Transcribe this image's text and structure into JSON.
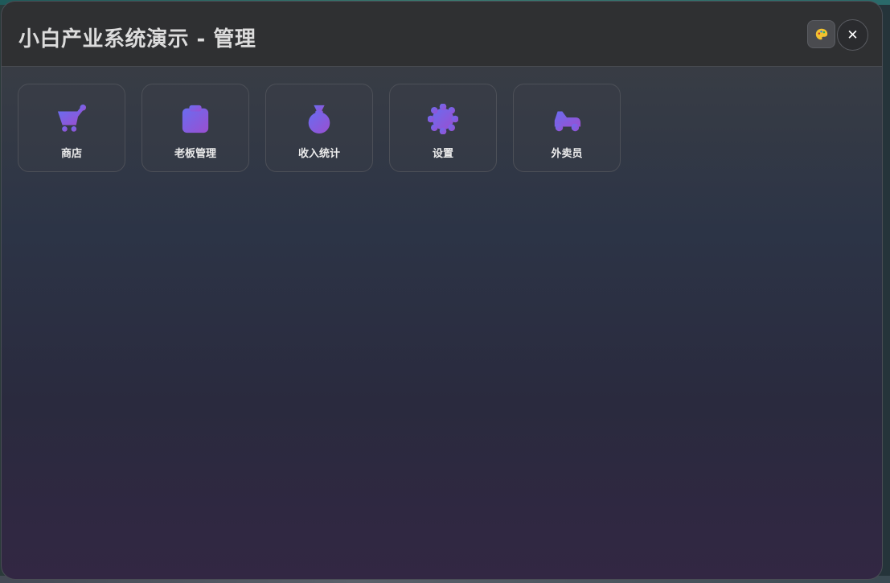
{
  "window": {
    "title": "小白产业系统演示 - 管理",
    "theme_button_icon": "palette-icon",
    "close_button_label": "✕"
  },
  "colors": {
    "accent_start": "#6a6cf0",
    "accent_end": "#9a4fd0",
    "palette_yellow": "#f2c230"
  },
  "tiles": [
    {
      "label": "商店",
      "icon": "cart-icon"
    },
    {
      "label": "老板管理",
      "icon": "clipboard-icon"
    },
    {
      "label": "收入统计",
      "icon": "money-bag-icon"
    },
    {
      "label": "设置",
      "icon": "gear-icon"
    },
    {
      "label": "外卖员",
      "icon": "delivery-scooter-icon"
    }
  ]
}
